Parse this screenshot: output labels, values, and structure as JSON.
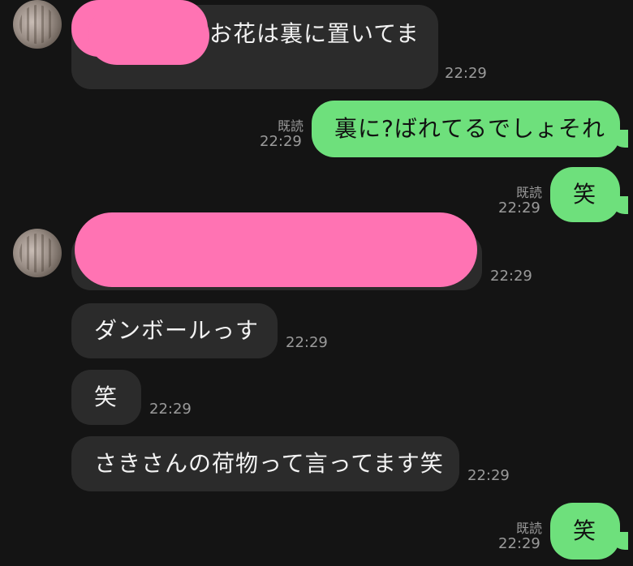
{
  "messages": {
    "m1": {
      "text_visible": "お花は裏に置いてま",
      "time": "22:29"
    },
    "m2": {
      "read": "既読",
      "time": "22:29",
      "text": "裏に?ばれてるでしょそれ"
    },
    "m3": {
      "read": "既読",
      "time": "22:29",
      "text": "笑"
    },
    "m4": {
      "time": "22:29"
    },
    "m5": {
      "text": "ダンボールっす",
      "time": "22:29"
    },
    "m6": {
      "text": "笑",
      "time": "22:29"
    },
    "m7": {
      "text": "さきさんの荷物って言ってます笑",
      "time": "22:29"
    },
    "m8": {
      "read": "既読",
      "time": "22:29",
      "text": "笑"
    }
  },
  "colors": {
    "background": "#141414",
    "incoming_bubble": "#2b2b2b",
    "outgoing_bubble": "#6ee07c",
    "redaction": "#ff73b3",
    "meta_text": "#9a9a9a"
  }
}
